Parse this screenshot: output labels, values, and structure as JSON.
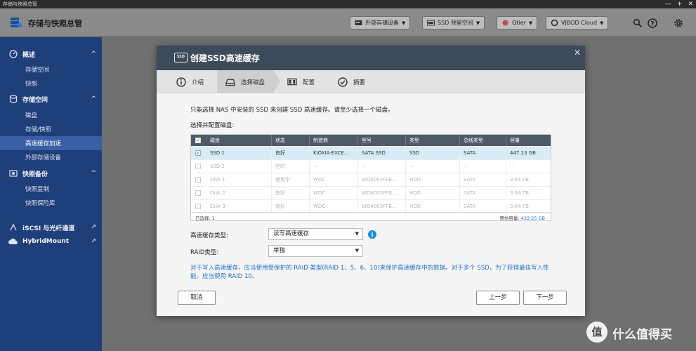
{
  "window": {
    "title": "存储与快照总管",
    "controls": [
      "—",
      "+",
      "✕"
    ]
  },
  "header": {
    "app_title": "存储与快照总管",
    "buttons": [
      {
        "label": "外部存储设备"
      },
      {
        "label": "SSD 预留空间"
      },
      {
        "label": "Qtier"
      },
      {
        "label": "VJBOD Cloud"
      }
    ]
  },
  "sidebar": {
    "sections": [
      {
        "label": "概述",
        "items": [
          "存储空间",
          "快照"
        ]
      },
      {
        "label": "存储空间",
        "items": [
          "磁盘",
          "存储/快照",
          "高速缓存加速",
          "外部存储设备"
        ]
      },
      {
        "label": "快照备份",
        "items": [
          "快照复制",
          "快照保险库"
        ]
      },
      {
        "label": "iSCSI 与光纤通道"
      },
      {
        "label": "HybridMount"
      }
    ],
    "active_item": "高速缓存加速"
  },
  "dialog": {
    "icon_text": "SSD",
    "title": "创建SSD高速缓存",
    "steps": [
      "介绍",
      "选择磁盘",
      "配置",
      "摘要"
    ],
    "active_step": "选择磁盘",
    "description": "只能选择 NAS 中安装的 SSD 来创建 SSD 高速缓存。请至少选择一个磁盘。",
    "subheading": "选择并配置磁盘:",
    "table": {
      "columns": [
        "磁盘",
        "状态",
        "制造商",
        "型号",
        "类型",
        "总线类型",
        "容量"
      ],
      "rows": [
        {
          "disk": "SSD 1",
          "status": "良好",
          "vendor": "KIOXIA-EXCE...",
          "model": "SATA SSD",
          "type": "SSD",
          "bus": "SATA",
          "capacity": "447.13 GB",
          "checked": true
        },
        {
          "disk": "SSD 2",
          "status": "空的",
          "vendor": "--",
          "model": "--",
          "type": "--",
          "bus": "--",
          "capacity": "--",
          "checked": false
        },
        {
          "disk": "Disk 1",
          "status": "使用中",
          "vendor": "WDC",
          "model": "WD4003FFB...",
          "type": "HDD",
          "bus": "SATA",
          "capacity": "3.64 TB",
          "checked": false
        },
        {
          "disk": "Disk 2",
          "status": "良好",
          "vendor": "WDC",
          "model": "WD4003FFB...",
          "type": "HDD",
          "bus": "SATA",
          "capacity": "3.64 TB",
          "checked": false
        },
        {
          "disk": "Disk 3",
          "status": "良好",
          "vendor": "WDC",
          "model": "WD4003FFB...",
          "type": "HDD",
          "bus": "SATA",
          "capacity": "3.64 TB",
          "checked": false
        }
      ],
      "footer_selected": "已选择: 1",
      "footer_capacity_label": "预估容量:",
      "footer_capacity_value": "433.25 GB"
    },
    "cache_type_label": "高速缓存类型:",
    "cache_type_value": "读写高速缓存",
    "raid_label": "RAID类型:",
    "raid_value": "单独",
    "note": "对于写入高速缓存，应当使用受保护的 RAID 类型(RAID 1、5、6、10)来保护高速缓存中的数据。对于多个 SSD，为了获得最佳写入性能，应当使用 RAID 10。",
    "buttons": {
      "cancel": "取消",
      "prev": "上一步",
      "next": "下一步"
    }
  },
  "watermark": {
    "badge": "值",
    "text": "什么值得买"
  },
  "colors": {
    "sidebar": "#1e3f7a",
    "sidebar_active": "#3a5fa6",
    "dialog_header": "#3c4a5a",
    "selected_row": "#d7ecf8",
    "note_text": "#1f6fc9"
  }
}
